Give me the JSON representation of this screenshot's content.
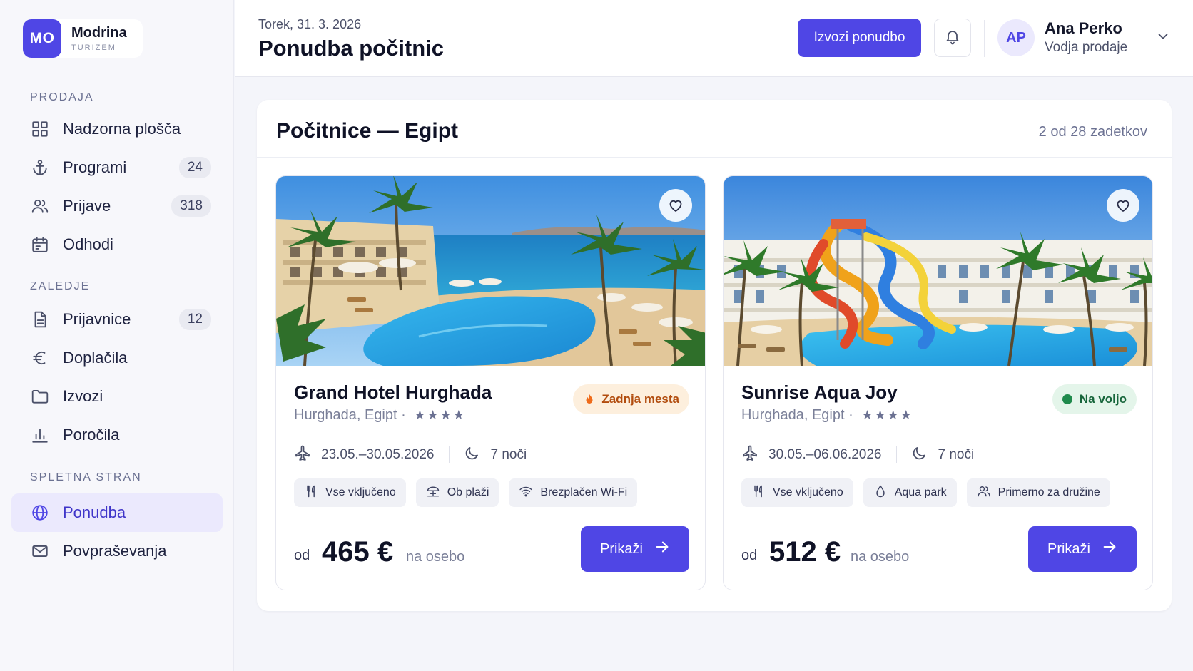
{
  "brand": {
    "logo": "MO",
    "name": "Modrina",
    "sub": "TURIZEM"
  },
  "sidebar": {
    "sections": [
      {
        "label": "PRODAJA"
      },
      {
        "label": "ZALEDJE"
      },
      {
        "label": "SPLETNA STRAN"
      }
    ],
    "items": [
      {
        "label": "Nadzorna plošča",
        "icon": "grid-icon"
      },
      {
        "label": "Programi",
        "icon": "anchor-icon",
        "count": "24"
      },
      {
        "label": "Prijave",
        "icon": "users-icon",
        "count": "318"
      },
      {
        "label": "Odhodi",
        "icon": "calendar-icon"
      },
      {
        "label": "Prijavnice",
        "icon": "document-icon",
        "count": "12"
      },
      {
        "label": "Doplačila",
        "icon": "euro-icon"
      },
      {
        "label": "Izvozi",
        "icon": "folder-icon"
      },
      {
        "label": "Poročila",
        "icon": "bar-chart-icon"
      },
      {
        "label": "Ponudba",
        "icon": "globe-icon",
        "active": true
      },
      {
        "label": "Povpraševanja",
        "icon": "mail-icon"
      }
    ]
  },
  "header": {
    "date": "Torek, 31. 3. 2026",
    "title": "Ponudba počitnic",
    "export_label": "Izvozi ponudbo",
    "user": {
      "initials": "AP",
      "name": "Ana Perko",
      "role": "Vodja prodaje"
    }
  },
  "panel": {
    "title": "Počitnice — Egipt",
    "count": "2 od 28 zadetkov"
  },
  "cards": [
    {
      "name": "Grand Hotel Hurghada",
      "location": "Hurghada, Egipt",
      "separator": "·",
      "stars": "★★★★",
      "badge": "Zadnja mesta",
      "badge_type": "hot",
      "dates": "23.05.–30.05.2026",
      "nights": "7 noči",
      "tags": [
        "Vse vključeno",
        "Ob plaži",
        "Brezplačen Wi-Fi"
      ],
      "price_from": "od",
      "price": "465 €",
      "price_per": "na osebo",
      "cta": "Prikaži"
    },
    {
      "name": "Sunrise Aqua Joy",
      "location": "Hurghada, Egipt",
      "separator": "·",
      "stars": "★★★★",
      "badge": "Na voljo",
      "badge_type": "ok",
      "dates": "30.05.–06.06.2026",
      "nights": "7 noči",
      "tags": [
        "Vse vključeno",
        "Aqua park",
        "Primerno za družine"
      ],
      "price_from": "od",
      "price": "512 €",
      "price_per": "na osebo",
      "cta": "Prikaži"
    }
  ],
  "colors": {
    "accent": "#4f46e5",
    "badge_hot_bg": "#fdefdd",
    "badge_ok_bg": "#e4f5ea"
  }
}
